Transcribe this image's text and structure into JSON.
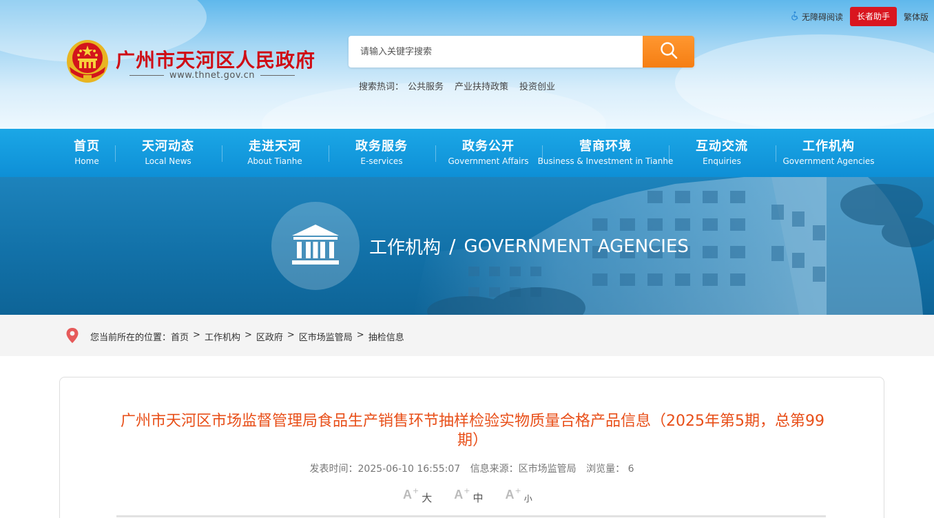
{
  "header": {
    "accessibility_label": "无障碍阅读",
    "elder_assist_label": "长者助手",
    "traditional_label": "繁体版",
    "site_title": "广州市天河区人民政府",
    "site_url": "www.thnet.gov.cn",
    "search": {
      "placeholder": "请输入关键字搜索",
      "hot_label": "搜索热词：",
      "hot_words": [
        "公共服务",
        "产业扶持政策",
        "投资创业"
      ]
    }
  },
  "nav": {
    "items": [
      {
        "cn": "首页",
        "en": "Home"
      },
      {
        "cn": "天河动态",
        "en": "Local News"
      },
      {
        "cn": "走进天河",
        "en": "About Tianhe"
      },
      {
        "cn": "政务服务",
        "en": "E-services"
      },
      {
        "cn": "政务公开",
        "en": "Government Affairs"
      },
      {
        "cn": "营商环境",
        "en": "Business & Investment in Tianhe"
      },
      {
        "cn": "互动交流",
        "en": "Enquiries"
      },
      {
        "cn": "工作机构",
        "en": "Government Agencies"
      }
    ]
  },
  "banner": {
    "title_cn": "工作机构",
    "slash": "/",
    "title_en": "GOVERNMENT AGENCIES"
  },
  "breadcrumb": {
    "prefix": "您当前所在的位置：",
    "items": [
      "首页",
      "工作机构",
      "区政府",
      "区市场监管局",
      "抽检信息"
    ],
    "separator": ">"
  },
  "article": {
    "title": "广州市天河区市场监督管理局食品生产销售环节抽样检验实物质量合格产品信息（2025年第5期，总第99期）",
    "publish_time": "发表时间：2025-06-10 16:55:07",
    "source": "信息来源：区市场监管局",
    "views": "浏览量：  6",
    "font_sizes": {
      "large": "大",
      "medium": "中",
      "small": "小",
      "glyph": "A",
      "plus": "+"
    }
  },
  "colors": {
    "brand_red": "#cf0d15",
    "nav_blue": "#1ba7e6",
    "search_orange": "#f57e13",
    "title_orange": "#e84f19"
  }
}
